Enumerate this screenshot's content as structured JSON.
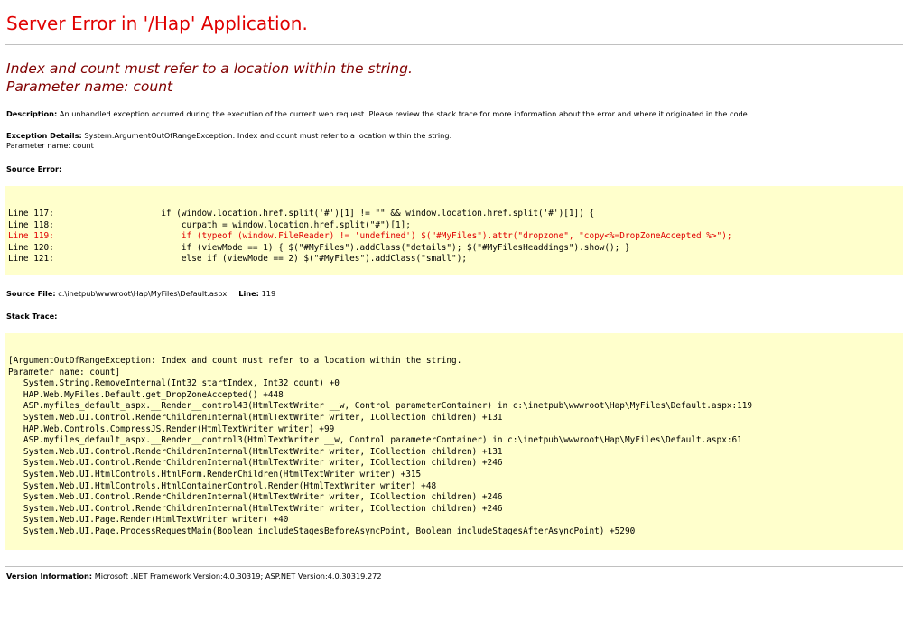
{
  "title": "Server Error in '/Hap' Application.",
  "error_message": {
    "line1": "Index and count must refer to a location within the string.",
    "line2": "Parameter name: count"
  },
  "description": {
    "label": "Description:",
    "text": "An unhandled exception occurred during the execution of the current web request. Please review the stack trace for more information about the error and where it originated in the code."
  },
  "exception_details": {
    "label": "Exception Details:",
    "text": "System.ArgumentOutOfRangeException: Index and count must refer to a location within the string.",
    "line2": "Parameter name: count"
  },
  "source_error": {
    "label": "Source Error:",
    "lines": [
      "Line 117:                     if (window.location.href.split('#')[1] != \"\" && window.location.href.split('#')[1]) {",
      "Line 118:                         curpath = window.location.href.split(\"#\")[1];",
      "Line 119:                         if (typeof (window.FileReader) != 'undefined') $(\"#MyFiles\").attr(\"dropzone\", \"copy<%=DropZoneAccepted %>\");",
      "Line 120:                         if (viewMode == 1) { $(\"#MyFiles\").addClass(\"details\"); $(\"#MyFilesHeaddings\").show(); }",
      "Line 121:                         else if (viewMode == 2) $(\"#MyFiles\").addClass(\"small\");"
    ],
    "highlight_line_index": 2
  },
  "source_file": {
    "label": "Source File:",
    "path": "c:\\inetpub\\wwwroot\\Hap\\MyFiles\\Default.aspx",
    "line_label": "Line:",
    "line_number": "119"
  },
  "stack_trace": {
    "label": "Stack Trace:",
    "lines": [
      "[ArgumentOutOfRangeException: Index and count must refer to a location within the string.",
      "Parameter name: count]",
      "   System.String.RemoveInternal(Int32 startIndex, Int32 count) +0",
      "   HAP.Web.MyFiles.Default.get_DropZoneAccepted() +448",
      "   ASP.myfiles_default_aspx.__Render__control43(HtmlTextWriter __w, Control parameterContainer) in c:\\inetpub\\wwwroot\\Hap\\MyFiles\\Default.aspx:119",
      "   System.Web.UI.Control.RenderChildrenInternal(HtmlTextWriter writer, ICollection children) +131",
      "   HAP.Web.Controls.CompressJS.Render(HtmlTextWriter writer) +99",
      "   ASP.myfiles_default_aspx.__Render__control3(HtmlTextWriter __w, Control parameterContainer) in c:\\inetpub\\wwwroot\\Hap\\MyFiles\\Default.aspx:61",
      "   System.Web.UI.Control.RenderChildrenInternal(HtmlTextWriter writer, ICollection children) +131",
      "   System.Web.UI.Control.RenderChildrenInternal(HtmlTextWriter writer, ICollection children) +246",
      "   System.Web.UI.HtmlControls.HtmlForm.RenderChildren(HtmlTextWriter writer) +315",
      "   System.Web.UI.HtmlControls.HtmlContainerControl.Render(HtmlTextWriter writer) +48",
      "   System.Web.UI.Control.RenderChildrenInternal(HtmlTextWriter writer, ICollection children) +246",
      "   System.Web.UI.Control.RenderChildrenInternal(HtmlTextWriter writer, ICollection children) +246",
      "   System.Web.UI.Page.Render(HtmlTextWriter writer) +40",
      "   System.Web.UI.Page.ProcessRequestMain(Boolean includeStagesBeforeAsyncPoint, Boolean includeStagesAfterAsyncPoint) +5290"
    ]
  },
  "version_info": {
    "label": "Version Information:",
    "text": "Microsoft .NET Framework Version:4.0.30319; ASP.NET Version:4.0.30319.272"
  },
  "colors": {
    "title": "#e00000",
    "error_message": "#800000",
    "code_background": "#ffffcc",
    "highlight_line": "#e00000",
    "rule": "#c0c0c0"
  }
}
